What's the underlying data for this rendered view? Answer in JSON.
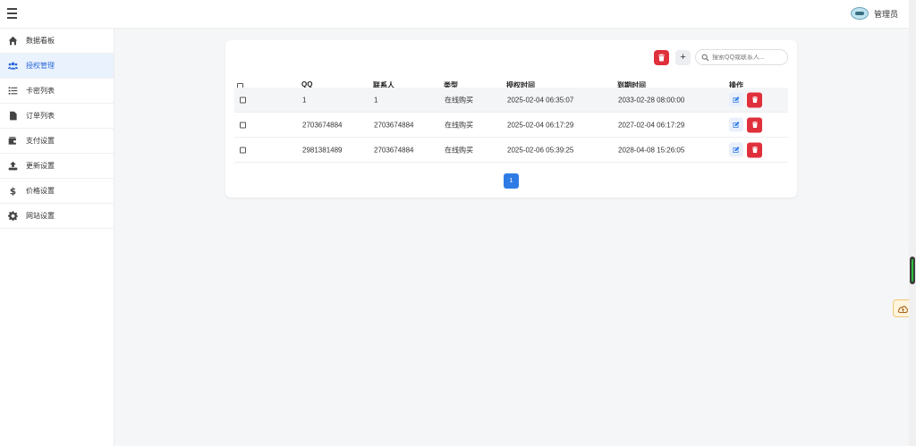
{
  "header": {
    "user_name": "管理员"
  },
  "sidebar": {
    "items": [
      {
        "label": "数据看板",
        "icon": "home-icon",
        "active": false
      },
      {
        "label": "授权管理",
        "icon": "users-icon",
        "active": true
      },
      {
        "label": "卡密列表",
        "icon": "list-icon",
        "active": false
      },
      {
        "label": "订单列表",
        "icon": "file-icon",
        "active": false
      },
      {
        "label": "支付设置",
        "icon": "wallet-icon",
        "active": false
      },
      {
        "label": "更新设置",
        "icon": "upload-icon",
        "active": false
      },
      {
        "label": "价格设置",
        "icon": "dollar-icon",
        "active": false
      },
      {
        "label": "网站设置",
        "icon": "gear-icon",
        "active": false
      }
    ]
  },
  "toolbar": {
    "add_label": "+",
    "search_placeholder": "搜索QQ或联系人..."
  },
  "table": {
    "headers": {
      "qq": "QQ",
      "contact": "联系人",
      "type": "类型",
      "auth_time": "授权时间",
      "expire_time": "到期时间",
      "actions": "操作"
    },
    "rows": [
      {
        "qq": "1",
        "contact": "1",
        "type": "在线购买",
        "auth_time": "2025-02-04 06:35:07",
        "expire_time": "2033-02-28 08:00:00"
      },
      {
        "qq": "2703674884",
        "contact": "2703674884",
        "type": "在线购买",
        "auth_time": "2025-02-04 06:17:29",
        "expire_time": "2027-02-04 06:17:29"
      },
      {
        "qq": "2981381489",
        "contact": "2703674884",
        "type": "在线购买",
        "auth_time": "2025-02-06 05:39:25",
        "expire_time": "2028-04-08 15:26:05"
      }
    ]
  },
  "pagination": {
    "current_page": "1"
  },
  "colors": {
    "accent": "#2f7be5",
    "danger": "#e0303c",
    "active_bg": "#eaf2fd"
  }
}
